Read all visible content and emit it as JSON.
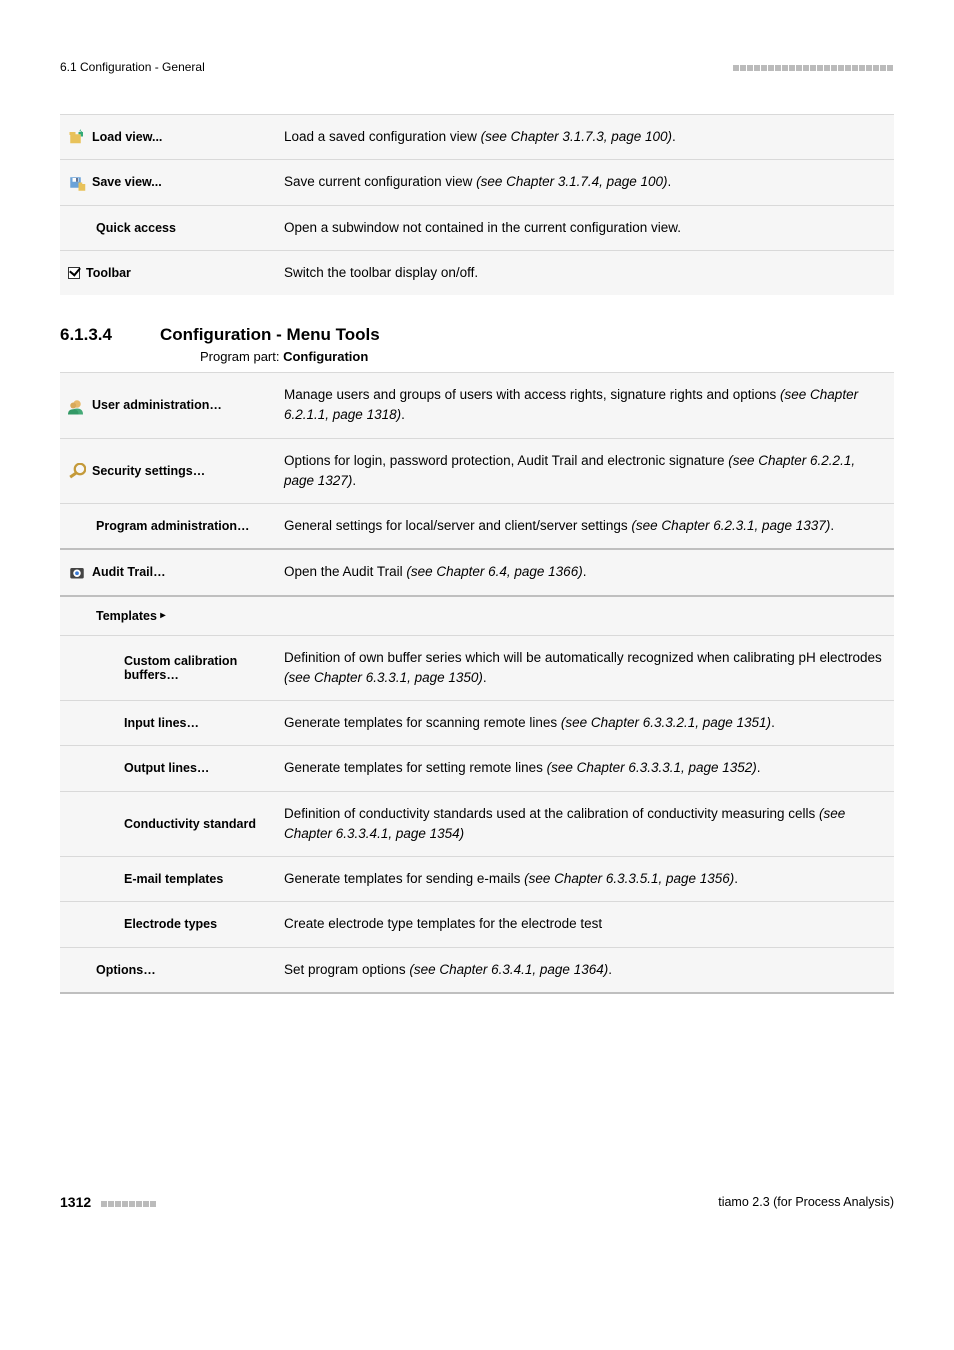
{
  "header": {
    "left": "6.1 Configuration - General"
  },
  "table1": {
    "rows": [
      {
        "icon": "load-view-icon",
        "label": "Load view...",
        "desc_pre": "Load a saved configuration view ",
        "desc_em": "(see Chapter 3.1.7.3, page 100)",
        "desc_post": "."
      },
      {
        "icon": "save-view-icon",
        "label": "Save view...",
        "desc_pre": "Save current configuration view ",
        "desc_em": "(see Chapter 3.1.7.4, page 100)",
        "desc_post": "."
      },
      {
        "icon": "",
        "indent": true,
        "label": "Quick access",
        "desc_pre": "Open a subwindow not contained in the current configuration view.",
        "desc_em": "",
        "desc_post": ""
      },
      {
        "icon": "checkbox-icon",
        "label": "Toolbar",
        "desc_pre": "Switch the toolbar display on/off.",
        "desc_em": "",
        "desc_post": ""
      }
    ]
  },
  "section": {
    "num": "6.1.3.4",
    "title": "Configuration - Menu Tools",
    "program_part_label": "Program part: ",
    "program_part_value": "Configuration"
  },
  "table2": {
    "rows": [
      {
        "icon": "user-admin-icon",
        "label": "User administration…",
        "desc_pre": "Manage users and groups of users with access rights, signature rights and options ",
        "desc_em": "(see Chapter 6.2.1.1, page 1318)",
        "desc_post": "."
      },
      {
        "icon": "security-icon",
        "label": "Security settings…",
        "desc_pre": "Options for login, password protection, Audit Trail and electronic signature ",
        "desc_em": "(see Chapter 6.2.2.1, page 1327)",
        "desc_post": "."
      },
      {
        "icon": "",
        "indent": true,
        "label": "Program administration…",
        "desc_pre": "General settings for local/server and client/server settings ",
        "desc_em": "(see Chapter 6.2.3.1, page 1337)",
        "desc_post": "."
      },
      {
        "icon": "audit-trail-icon",
        "label": "Audit Trail…",
        "desc_pre": "Open the Audit Trail ",
        "desc_em": "(see Chapter 6.4, page 1366)",
        "desc_post": "."
      },
      {
        "icon": "",
        "indent": true,
        "label": "Templates ▸",
        "desc_pre": "",
        "desc_em": "",
        "desc_post": "",
        "submenu_header": true
      },
      {
        "icon": "",
        "indent2": true,
        "label": "Custom calibration buffers…",
        "desc_pre": "Definition of own buffer series which will be automatically recognized when calibrating pH electrodes ",
        "desc_em": "(see Chapter 6.3.3.1, page 1350)",
        "desc_post": "."
      },
      {
        "icon": "",
        "indent2": true,
        "label": "Input lines…",
        "desc_pre": "Generate templates for scanning remote lines ",
        "desc_em": "(see Chapter 6.3.3.2.1, page 1351)",
        "desc_post": "."
      },
      {
        "icon": "",
        "indent2": true,
        "label": "Output lines…",
        "desc_pre": "Generate templates for setting remote lines ",
        "desc_em": "(see Chapter 6.3.3.3.1, page 1352)",
        "desc_post": "."
      },
      {
        "icon": "",
        "indent2": true,
        "label": "Conductivity standard",
        "desc_pre": "Definition of conductivity standards used at the calibration of conductivity measuring cells ",
        "desc_em": "(see Chapter 6.3.3.4.1, page 1354)",
        "desc_post": ""
      },
      {
        "icon": "",
        "indent2": true,
        "label": "E-mail templates",
        "desc_pre": "Generate templates for sending e-mails ",
        "desc_em": "(see Chapter 6.3.3.5.1, page 1356)",
        "desc_post": "."
      },
      {
        "icon": "",
        "indent2": true,
        "label": "Electrode types",
        "desc_pre": "Create electrode type templates for the electrode test",
        "desc_em": "",
        "desc_post": ""
      },
      {
        "icon": "",
        "indent": true,
        "label": "Options…",
        "desc_pre": "Set program options ",
        "desc_em": "(see Chapter 6.3.4.1, page 1364)",
        "desc_post": "."
      }
    ]
  },
  "footer": {
    "page": "1312",
    "right": "tiamo 2.3 (for Process Analysis)"
  }
}
